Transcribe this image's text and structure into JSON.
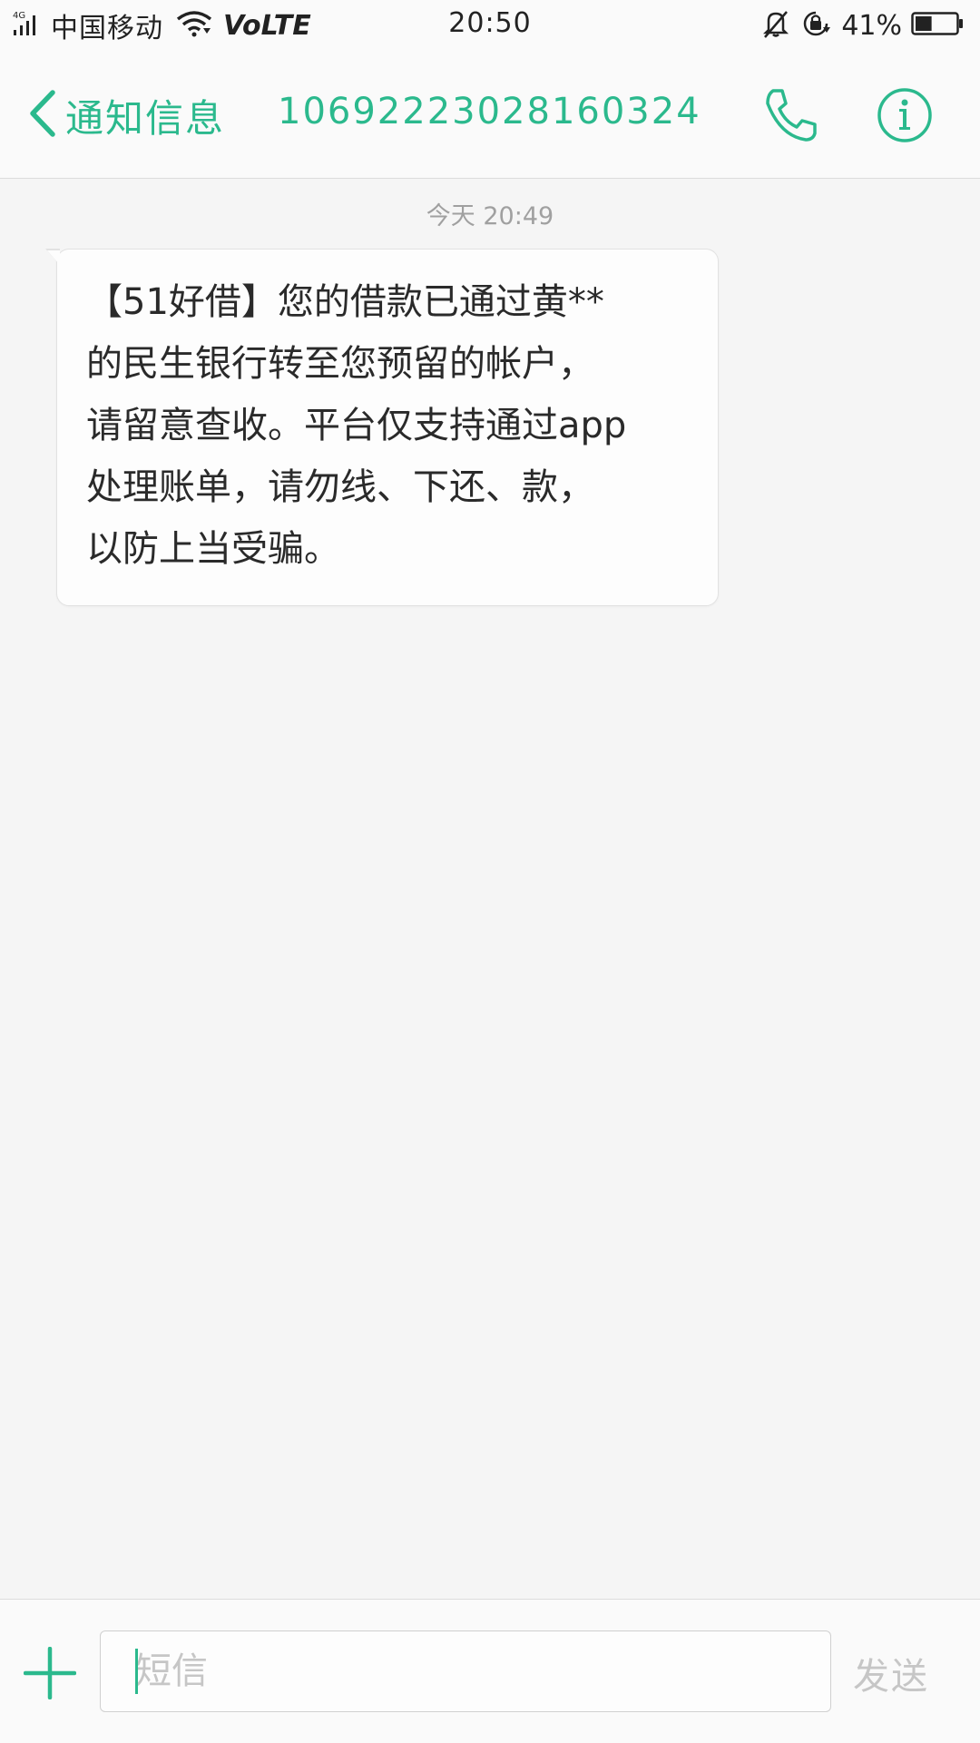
{
  "status_bar": {
    "network_type": "4G",
    "carrier": "中国移动",
    "volte": "VoLTE",
    "time": "20:50",
    "battery_percent": "41%",
    "battery_level": 0.41,
    "icons": [
      "signal-icon",
      "wifi-icon",
      "mute-bell-icon",
      "rotation-lock-icon",
      "battery-icon"
    ]
  },
  "header": {
    "back_label": "通知信息",
    "contact_number": "10692223028160324",
    "icons": [
      "chevron-left-icon",
      "phone-icon",
      "info-icon"
    ],
    "accent_color": "#2bb98d"
  },
  "conversation": {
    "timestamp": "今天 20:49",
    "messages": [
      {
        "direction": "incoming",
        "lines": [
          "【51好借】您的借款已通过黄**",
          "的民生银行转至您预留的帐户，",
          "请留意查收。平台仅支持通过app",
          "处理账单，请勿线、下还、款，",
          "以防上当受骗。"
        ]
      }
    ]
  },
  "composer": {
    "placeholder": "短信",
    "send_label": "发送",
    "icons": [
      "plus-icon"
    ]
  }
}
